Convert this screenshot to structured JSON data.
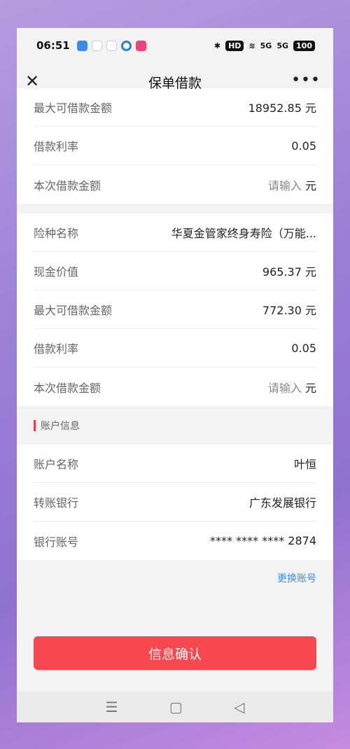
{
  "status": {
    "time": "06:51",
    "hd": "HD",
    "signal1": "5G",
    "signal2": "5G",
    "battery": "100"
  },
  "nav": {
    "title": "保单借款",
    "close": "✕",
    "more": "•••"
  },
  "policy1": [
    {
      "label": "最大可借款金额",
      "value": "18952.85 元"
    },
    {
      "label": "借款利率",
      "value": "0.05"
    },
    {
      "label": "本次借款金额",
      "placeholder": "请输入",
      "unit": "元"
    }
  ],
  "policy2": [
    {
      "label": "险种名称",
      "value": "华夏金管家终身寿险（万能..."
    },
    {
      "label": "现金价值",
      "value": "965.37 元"
    },
    {
      "label": "最大可借款金额",
      "value": "772.30 元"
    },
    {
      "label": "借款利率",
      "value": "0.05"
    },
    {
      "label": "本次借款金额",
      "placeholder": "请输入",
      "unit": "元"
    }
  ],
  "account": {
    "section_title": "账户信息",
    "rows": [
      {
        "label": "账户名称",
        "value": "叶恒"
      },
      {
        "label": "转账银行",
        "value": "广东发展银行"
      },
      {
        "label": "银行账号",
        "value": "**** **** **** 2874"
      }
    ],
    "change_link": "更换账号"
  },
  "confirm_button": "信息确认",
  "system_nav": {
    "menu": "☰",
    "home": "▢",
    "back": "◁"
  },
  "colors": {
    "accent": "#f7474f",
    "link": "#3b8fd6"
  }
}
